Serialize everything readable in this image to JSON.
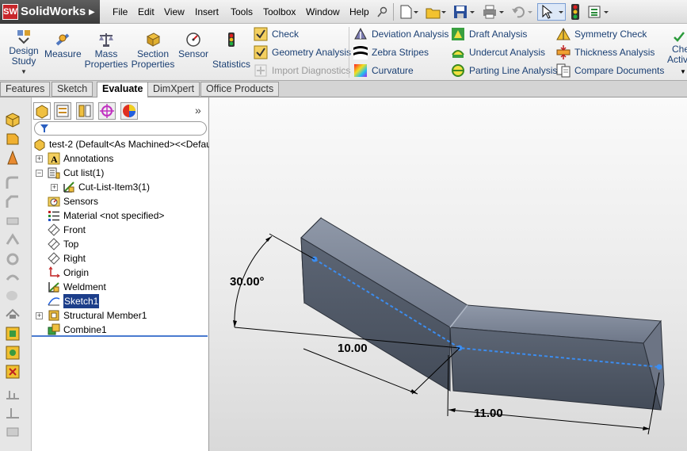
{
  "app": {
    "logo_text": "SolidWorks",
    "logo_badge": "SW"
  },
  "menu": [
    "File",
    "Edit",
    "View",
    "Insert",
    "Tools",
    "Toolbox",
    "Window",
    "Help"
  ],
  "quick_toolbar": [
    "new-icon",
    "open-icon",
    "save-icon",
    "print-icon",
    "undo-icon",
    "select-icon",
    "rebuild-icon",
    "options-icon"
  ],
  "command_manager": {
    "large_buttons": [
      {
        "label1": "Design",
        "label2": "Study",
        "icon": "design-study-icon"
      },
      {
        "label1": "Measure",
        "label2": "",
        "icon": "measure-icon"
      },
      {
        "label1": "Mass",
        "label2": "Properties",
        "icon": "mass-properties-icon"
      },
      {
        "label1": "Section",
        "label2": "Properties",
        "icon": "section-properties-icon"
      },
      {
        "label1": "Sensor",
        "label2": "",
        "icon": "sensor-icon"
      },
      {
        "label1": "Statistics",
        "label2": "",
        "icon": "statistics-icon"
      }
    ],
    "col1": [
      "Check",
      "Geometry Analysis",
      "Import Diagnostics"
    ],
    "col2": [
      "Deviation Analysis",
      "Zebra Stripes",
      "Curvature"
    ],
    "col3": [
      "Draft Analysis",
      "Undercut Analysis",
      "Parting Line Analysis"
    ],
    "col4": [
      "Symmetry Check",
      "Thickness Analysis",
      "Compare Documents"
    ],
    "col5": [
      "Che",
      "Activ"
    ]
  },
  "tabs": [
    "Features",
    "Sketch",
    "Evaluate",
    "DimXpert",
    "Office Products"
  ],
  "active_tab": "Evaluate",
  "tree": {
    "root": "test-2  (Default<As Machined><<Default",
    "items": [
      {
        "label": "Annotations",
        "expander": "+",
        "icon": "annotations-icon"
      },
      {
        "label": "Cut list(1)",
        "expander": "−",
        "icon": "cut-list-icon"
      },
      {
        "label": "Cut-List-Item3(1)",
        "expander": "+",
        "icon": "cut-list-item-icon"
      },
      {
        "label": "Sensors",
        "expander": "",
        "icon": "sensors-icon"
      },
      {
        "label": "Material <not specified>",
        "expander": "",
        "icon": "material-icon"
      },
      {
        "label": "Front",
        "expander": "",
        "icon": "plane-icon"
      },
      {
        "label": "Top",
        "expander": "",
        "icon": "plane-icon"
      },
      {
        "label": "Right",
        "expander": "",
        "icon": "plane-icon"
      },
      {
        "label": "Origin",
        "expander": "",
        "icon": "origin-icon"
      },
      {
        "label": "Weldment",
        "expander": "",
        "icon": "weldment-icon"
      },
      {
        "label": "Sketch1",
        "expander": "",
        "icon": "sketch-icon"
      },
      {
        "label": "Structural Member1",
        "expander": "+",
        "icon": "structural-member-icon"
      },
      {
        "label": "Combine1",
        "expander": "",
        "icon": "combine-icon"
      }
    ]
  },
  "dimensions": {
    "angle": "30.00°",
    "len1": "10.00",
    "len2": "11.00"
  },
  "colors": {
    "accent": "#1c3e8a",
    "part": "#5d6675",
    "sketch": "#3c8df0"
  }
}
